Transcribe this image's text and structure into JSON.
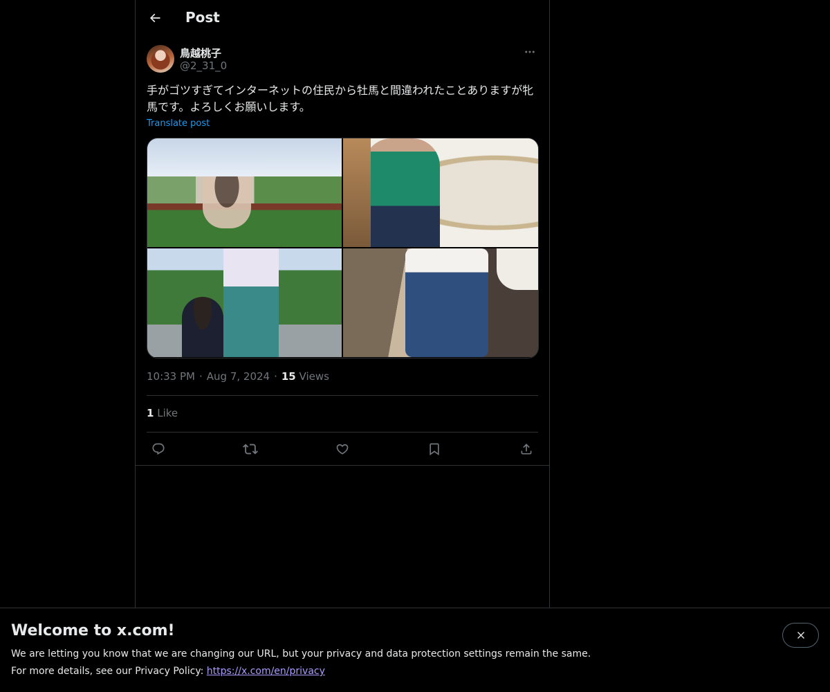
{
  "header": {
    "title": "Post",
    "back_icon": "arrow-left-icon"
  },
  "author": {
    "display_name": "鳥越桃子",
    "handle": "@2_31_0"
  },
  "post": {
    "text": "手がゴツすぎてインターネットの住民から牡馬と間違われたことありますが牝馬です。よろしくお願いします。",
    "translate_label": "Translate post",
    "time": "10:33 PM",
    "date": "Aug 7, 2024",
    "views_count": "15",
    "views_label": "Views",
    "likes_count": "1",
    "likes_label": "Like",
    "separator": "·"
  },
  "actions": [
    "reply-icon",
    "repost-icon",
    "like-icon",
    "bookmark-icon",
    "share-icon"
  ],
  "banner": {
    "title": "Welcome to x.com!",
    "line1": "We are letting you know that we are changing our URL, but your privacy and data protection settings remain the same.",
    "line2_prefix": "For more details, see our Privacy Policy: ",
    "link_text": "https://x.com/en/privacy"
  },
  "colors": {
    "background": "#000000",
    "text": "#e7e9ea",
    "muted": "#71767b",
    "link": "#1d9bf0",
    "border": "#2f3336"
  }
}
